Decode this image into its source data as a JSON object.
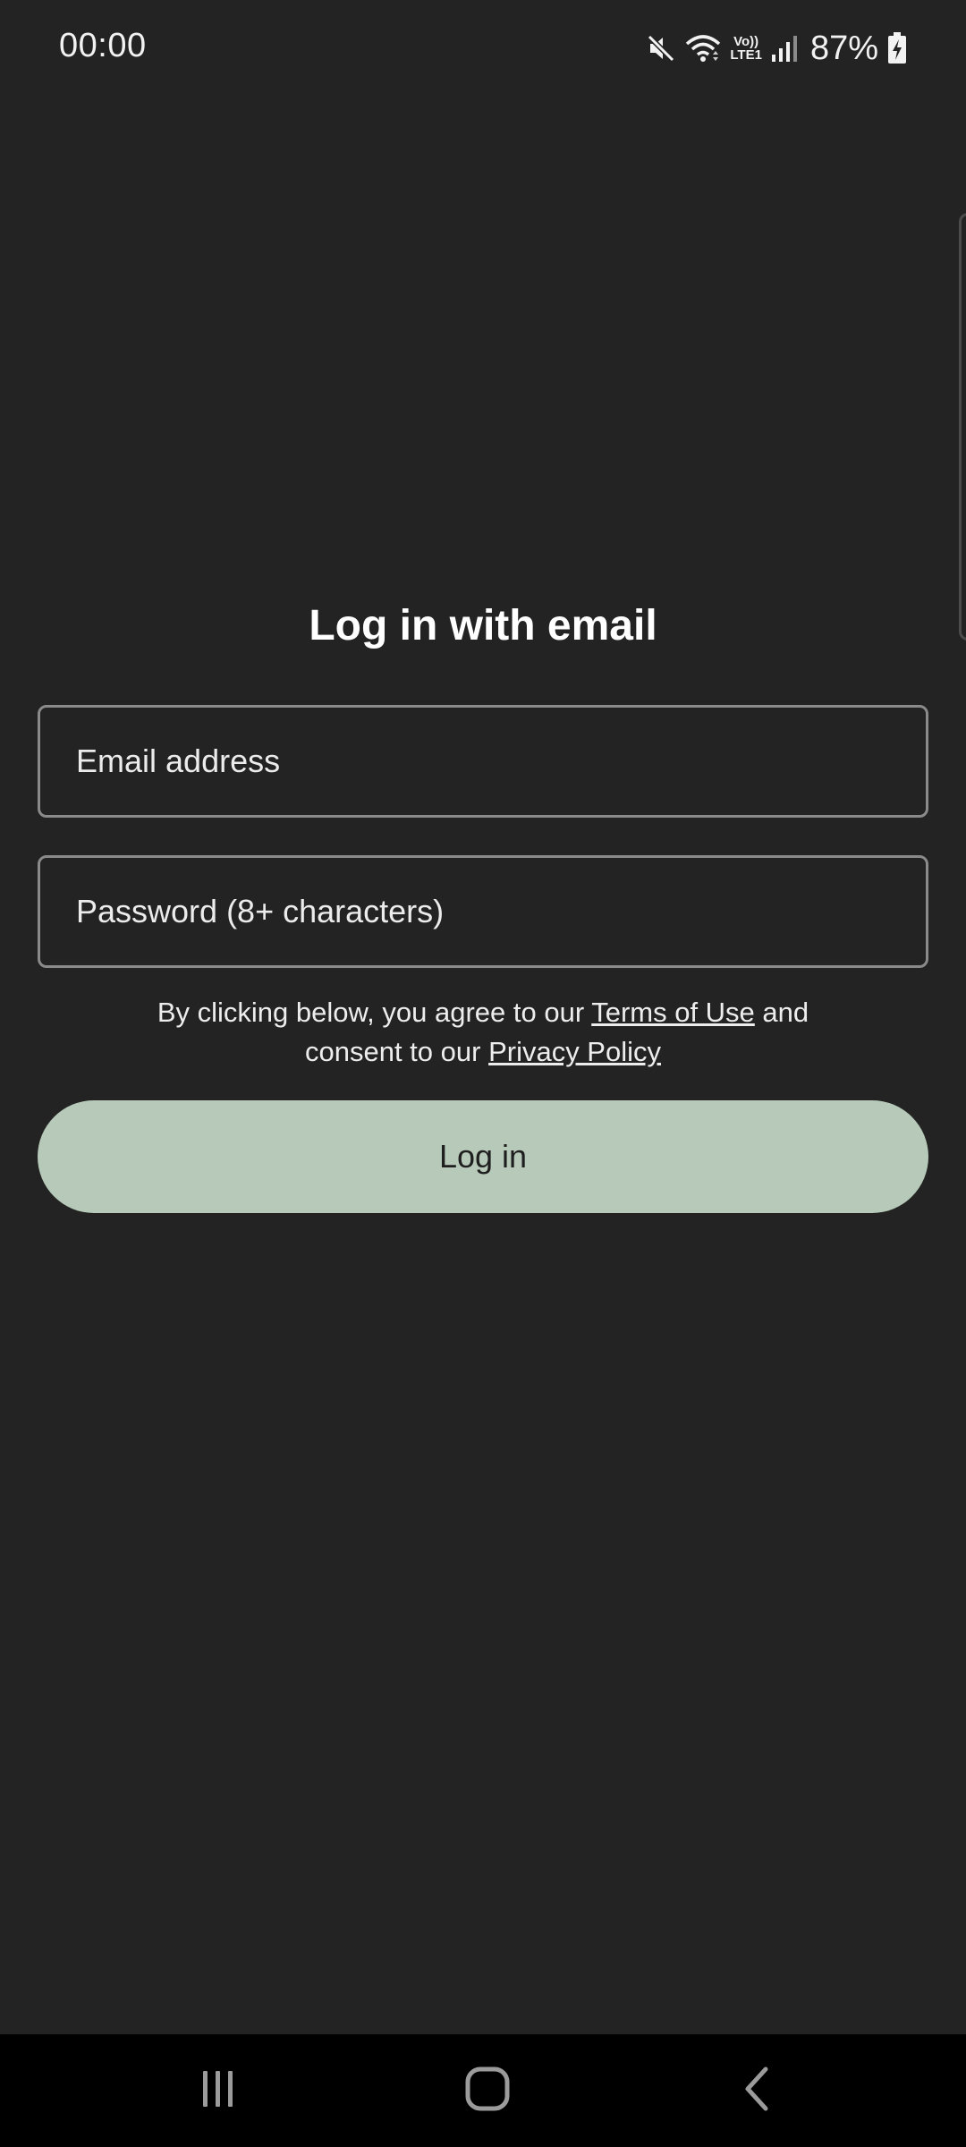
{
  "status_bar": {
    "time": "00:00",
    "network_label_top": "Vo))",
    "network_label_bottom": "LTE1",
    "battery_percent": "87%",
    "icons": [
      "mute-icon",
      "wifi-icon",
      "volte-lte-icon",
      "signal-icon",
      "battery-charging-icon"
    ]
  },
  "login": {
    "title": "Log in with email",
    "email_placeholder": "Email address",
    "email_value": "",
    "password_placeholder": "Password (8+ characters)",
    "password_value": "",
    "consent_prefix": "By clicking below, you agree to our ",
    "terms_link": "Terms of Use",
    "consent_middle": " and consent to our ",
    "privacy_link": "Privacy Policy",
    "login_button": "Log in"
  },
  "colors": {
    "background": "#232323",
    "button_accent": "#b7cab9",
    "field_border": "#8a8a8a",
    "nav_bar": "#000000"
  },
  "nav_bar": {
    "icons": [
      "recents-icon",
      "home-icon",
      "back-icon"
    ]
  }
}
